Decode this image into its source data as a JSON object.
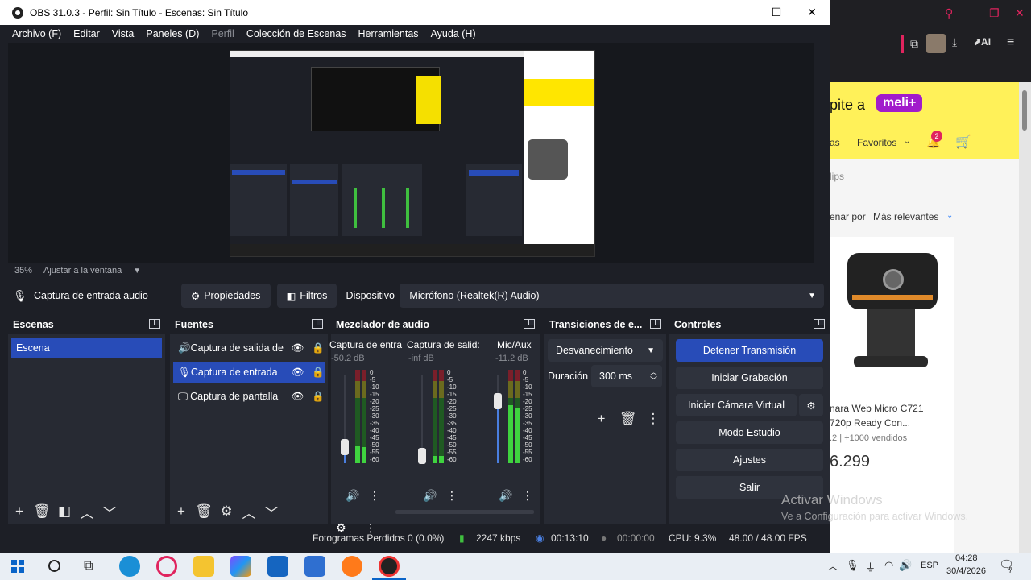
{
  "window": {
    "title": "OBS 31.0.3 - Perfil: Sin Título - Escenas: Sin Título"
  },
  "menu": [
    {
      "label": "Archivo (F)",
      "disabled": false
    },
    {
      "label": "Editar",
      "disabled": false
    },
    {
      "label": "Vista",
      "disabled": false
    },
    {
      "label": "Paneles (D)",
      "disabled": false
    },
    {
      "label": "Perfil",
      "disabled": true
    },
    {
      "label": "Colección de Escenas",
      "disabled": false
    },
    {
      "label": "Herramientas",
      "disabled": false
    },
    {
      "label": "Ayuda (H)",
      "disabled": false
    }
  ],
  "preview": {
    "zoom": "35%",
    "fit_label": "Ajustar a la ventana"
  },
  "source_bar": {
    "source_name": "Captura de entrada audio",
    "properties": "Propiedades",
    "filters": "Filtros",
    "device_label": "Dispositivo",
    "device_value": "Micrófono (Realtek(R) Audio)"
  },
  "scenes": {
    "title": "Escenas",
    "items": [
      "Escena"
    ]
  },
  "sources": {
    "title": "Fuentes",
    "items": [
      "Captura de salida de",
      "Captura de entrada",
      "Captura de pantalla"
    ]
  },
  "mixer": {
    "title": "Mezclador de audio",
    "channels": [
      {
        "name": "Captura de entra",
        "db": "-50.2 dB",
        "level": 0.18
      },
      {
        "name": "Captura de salid:",
        "db": "-inf dB",
        "level": 0.08
      },
      {
        "name": "Mic/Aux",
        "db": "-11.2 dB",
        "level": 0.62
      }
    ],
    "ticks": [
      "0",
      "-5",
      "-10",
      "-15",
      "-20",
      "-25",
      "-30",
      "-35",
      "-40",
      "-45",
      "-50",
      "-55",
      "-60"
    ]
  },
  "transitions": {
    "title": "Transiciones de e...",
    "type": "Desvanecimiento",
    "duration_label": "Duración",
    "duration_value": "300 ms"
  },
  "controls": {
    "title": "Controles",
    "stop_stream": "Detener Transmisión",
    "start_recording": "Iniciar Grabación",
    "start_virtual_cam": "Iniciar Cámara Virtual",
    "studio_mode": "Modo Estudio",
    "settings": "Ajustes",
    "exit": "Salir"
  },
  "status": {
    "dropped_frames": "Fotogramas Perdidos 0 (0.0%)",
    "bitrate": "2247 kbps",
    "stream_time": "00:13:10",
    "rec_time": "00:00:00",
    "cpu": "CPU: 9.3%",
    "fps": "48.00 / 48.00 FPS"
  },
  "browser": {
    "banner": "pite a",
    "brand": "meli+",
    "favorites": "Favoritos",
    "cart_badge": "2",
    "clips_text": "lips",
    "sort_prefix": "enar por",
    "sort_value": "Más relevantes",
    "product_title": "nara Web Micro C721",
    "product_subtitle": "720p Ready Con...",
    "rating": ".2 | +1000 vendidos",
    "price": "6.299",
    "watermark_title": "Activar Windows",
    "watermark_sub": "Ve a Configuración para activar Windows."
  },
  "taskbar": {
    "lang": "ESP",
    "time": "04:28",
    "date": "30/4/2026",
    "notifications": "7"
  },
  "colors": {
    "accent": "#284cb8",
    "panel": "#272a33",
    "background": "#1d1f26"
  }
}
